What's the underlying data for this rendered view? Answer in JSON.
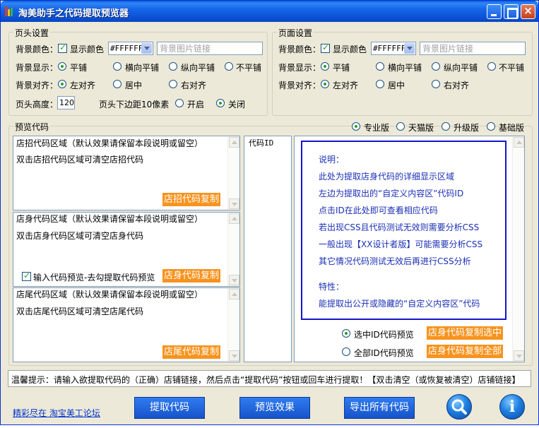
{
  "window": {
    "title": "淘美助手之代码提取预览器",
    "close_glyph": "×"
  },
  "header_settings": {
    "group_title": "页头设置",
    "bg_color_label": "背景颜色：",
    "show_color_label": "显示颜色",
    "show_color_checked": true,
    "color_value": "#FFFFFF",
    "bg_image_placeholder": "背景图片链接",
    "bg_display_label": "背景显示：",
    "bg_display_options": [
      "平铺",
      "横向平铺",
      "纵向平铺",
      "不平铺"
    ],
    "bg_display_selected": 0,
    "bg_align_label": "背景对齐：",
    "bg_align_options": [
      "左对齐",
      "居中",
      "右对齐"
    ],
    "bg_align_selected": 0,
    "height_label": "页头高度：",
    "height_value": "120",
    "margin_label": "页头下边距10像素",
    "margin_options": [
      "开启",
      "关闭"
    ],
    "margin_selected": 1
  },
  "page_settings": {
    "group_title": "页面设置",
    "bg_color_label": "背景颜色：",
    "show_color_label": "显示颜色",
    "show_color_checked": true,
    "color_value": "#FFFFFF",
    "bg_image_placeholder": "背景图片链接",
    "bg_display_label": "背景显示：",
    "bg_display_options": [
      "平铺",
      "横向平铺",
      "纵向平铺",
      "不平铺"
    ],
    "bg_display_selected": 0,
    "bg_align_label": "背景对齐：",
    "bg_align_options": [
      "左对齐",
      "居中",
      "右对齐"
    ],
    "bg_align_selected": 0
  },
  "preview": {
    "group_title": "预览代码",
    "versions": [
      "专业版",
      "天猫版",
      "升级版",
      "基础版"
    ],
    "version_selected": 0,
    "sign_area": {
      "line1": "店招代码区域（默认效果请保留本段说明或留空）",
      "line2": "双击店招代码区域可清空店招代码",
      "copy_label": "店招代码复制"
    },
    "body_area": {
      "line1": "店身代码区域（默认效果请保留本段说明或留空）",
      "line2": "双击店身代码区域可清空店身代码",
      "preview_check_label": "输入代码预览-去勾提取代码预览",
      "preview_check_checked": true,
      "copy_label": "店身代码复制"
    },
    "tail_area": {
      "line1": "店尾代码区域（默认效果请保留本段说明或留空）",
      "line2": "双击店尾代码区域可清空店尾代码",
      "copy_label": "店尾代码复制"
    },
    "code_id_header": "代码ID",
    "info": {
      "title": "说明：",
      "lines": [
        "此处为提取店身代码的详细显示区域",
        "左边为提取出的“自定义内容区”代码ID",
        "点击ID在此处即可查看相应代码",
        "若出现CSS且代码测试无效则需要分析CSS",
        "一般出现【XX设计者版】可能需要分析CSS",
        "其它情况代码测试无效后再进行CSS分析"
      ],
      "feature_title": "特性：",
      "feature_line": "能提取出公开或隐藏的“自定义内容区”代码"
    },
    "selected_preview_label": "选中ID代码预览",
    "all_preview_label": "全部ID代码预览",
    "preview_selected": 0,
    "copy_selected_label": "店身代码复制选中",
    "copy_all_label": "店身代码复制全部"
  },
  "status": {
    "tip": "温馨提示：请输入欲提取代码的（正确）店铺链接，然后点击“提取代码”按钮或回车进行提取！【双击清空（或恢复被清空）店铺链接】"
  },
  "footer": {
    "link": "精彩尽在 淘宝美工论坛",
    "extract_button": "提取代码",
    "preview_button": "预览效果",
    "export_button": "导出所有代码",
    "search_icon": "magnifier-icon",
    "info_icon": "info-icon",
    "info_glyph": "i"
  },
  "colors": {
    "accent_orange": "#f7931e",
    "title_blue": "#1565e8",
    "info_text": "#1a2fb5",
    "info_border": "#1515c8"
  }
}
